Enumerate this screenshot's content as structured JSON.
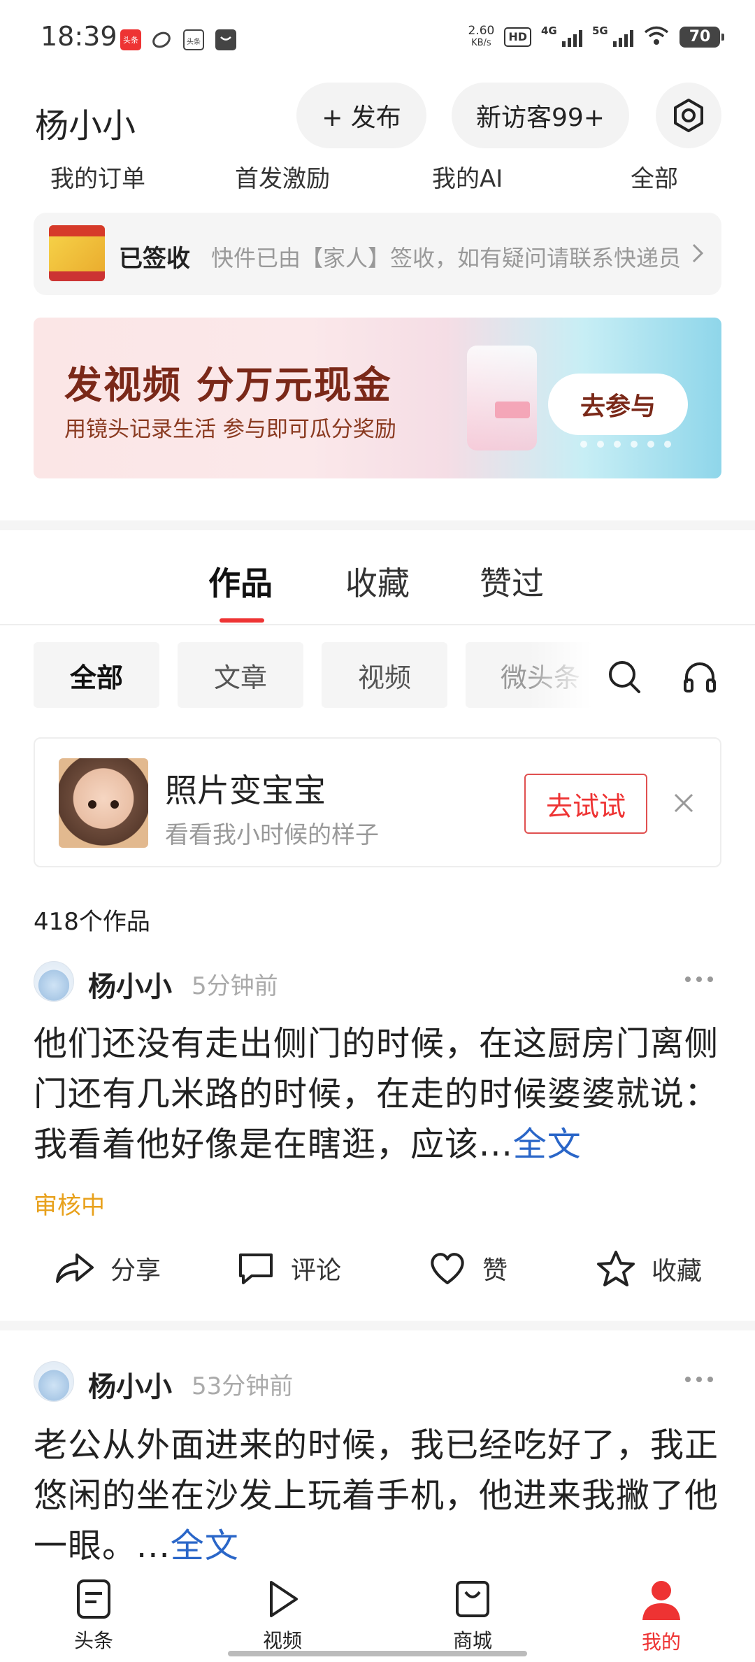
{
  "status_bar": {
    "time": "18:39",
    "app_badges": [
      "头条",
      "头条"
    ],
    "net_speed": "2.60",
    "net_unit": "KB/s",
    "hd": "HD",
    "sim1": "4G",
    "sim2": "5G",
    "battery": "70"
  },
  "header": {
    "username": "杨小小",
    "publish_label": "+ 发布",
    "visitors_label": "新访客99+",
    "settings_icon": "gear-icon"
  },
  "quick_nav": [
    "我的订单",
    "首发激励",
    "我的AI",
    "全部"
  ],
  "delivery_notice": {
    "title": "已签收",
    "desc": "快件已由【家人】签收，如有疑问请联系快递员"
  },
  "banner": {
    "headline": "发视频 分万元现金",
    "subline": "用镜头记录生活 参与即可瓜分奖励",
    "cta": "去参与",
    "dots": 6
  },
  "content_tabs": [
    {
      "label": "作品",
      "active": true
    },
    {
      "label": "收藏",
      "active": false
    },
    {
      "label": "赞过",
      "active": false
    }
  ],
  "filters": [
    {
      "label": "全部",
      "active": true
    },
    {
      "label": "文章",
      "active": false
    },
    {
      "label": "视频",
      "active": false
    },
    {
      "label": "微头条",
      "active": false
    }
  ],
  "promo_card": {
    "title": "照片变宝宝",
    "subtitle": "看看我小时候的样子",
    "button": "去试试"
  },
  "works_count": "418个作品",
  "posts": [
    {
      "author": "杨小小",
      "time": "5分钟前",
      "text": "他们还没有走出侧门的时候，在这厨房门离侧门还有几米路的时候，在走的时候婆婆就说：我看着他好像是在瞎逛，应该...",
      "more": "全文",
      "status": "审核中"
    },
    {
      "author": "杨小小",
      "time": "53分钟前",
      "text": "老公从外面进来的时候，我已经吃好了，我正悠闲的坐在沙发上玩着手机，他进来我撇了他一眼。...",
      "more": "全文"
    }
  ],
  "actions": [
    "分享",
    "评论",
    "赞",
    "收藏"
  ],
  "bottom_nav": [
    {
      "label": "头条",
      "icon": "article-icon"
    },
    {
      "label": "视频",
      "icon": "play-icon"
    },
    {
      "label": "商城",
      "icon": "shopping-bag-icon"
    },
    {
      "label": "我的",
      "icon": "profile-icon",
      "active": true
    }
  ],
  "colors": {
    "accent_red": "#e33333",
    "link_blue": "#2a66c8",
    "review_orange": "#e8a11c"
  }
}
